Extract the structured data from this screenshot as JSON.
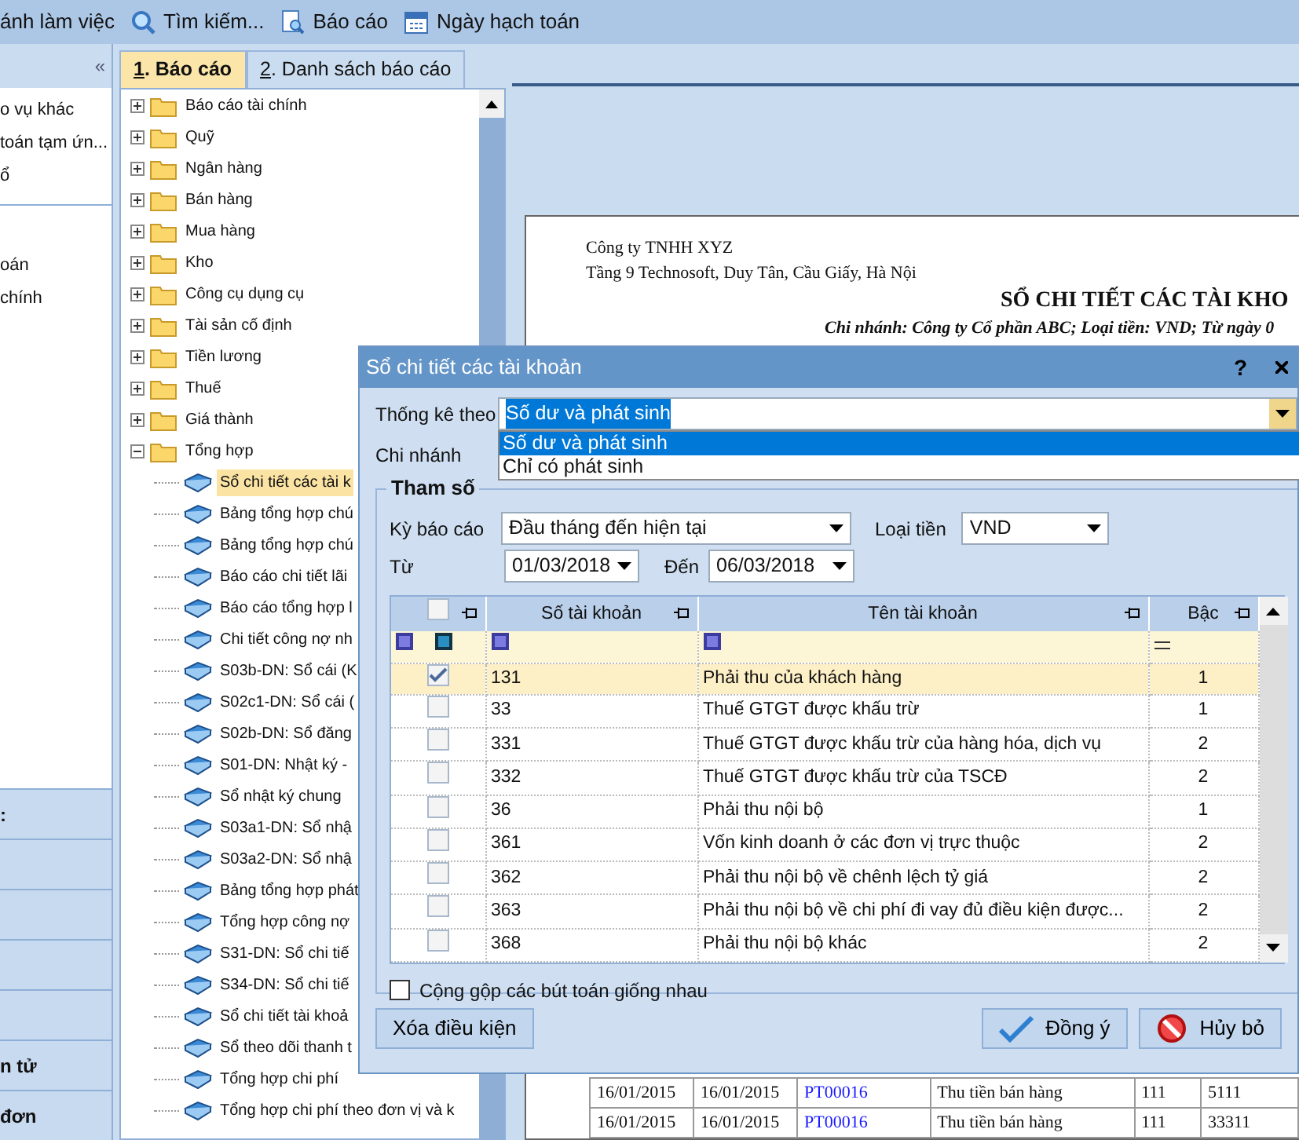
{
  "toolbar": [
    {
      "label": "ánh làm việc"
    },
    {
      "label": "Tìm kiếm..."
    },
    {
      "label": "Báo cáo"
    },
    {
      "label": "Ngày hạch toán"
    }
  ],
  "left_pane": {
    "collapse_glyph": "«",
    "list_1": [
      "o vụ khác",
      "toán tạm ứn...",
      "ổ"
    ],
    "list_2": [
      "oán",
      "chính"
    ],
    "nav_buttons": [
      ":",
      "n tử",
      "đơn"
    ]
  },
  "tabs": [
    {
      "number": "1",
      "label": ". Báo cáo",
      "selected": true
    },
    {
      "number": "2",
      "label": ". Danh sách báo cáo",
      "selected": false
    }
  ],
  "tree": [
    {
      "label": "Báo cáo tài chính",
      "expanded": false
    },
    {
      "label": "Quỹ",
      "expanded": false
    },
    {
      "label": "Ngân hàng",
      "expanded": false
    },
    {
      "label": "Bán hàng",
      "expanded": false
    },
    {
      "label": "Mua hàng",
      "expanded": false
    },
    {
      "label": "Kho",
      "expanded": false
    },
    {
      "label": "Công cụ dụng cụ",
      "expanded": false
    },
    {
      "label": "Tài sản cố định",
      "expanded": false
    },
    {
      "label": "Tiền lương",
      "expanded": false
    },
    {
      "label": "Thuế",
      "expanded": false
    },
    {
      "label": "Giá thành",
      "expanded": false
    },
    {
      "label": "Tổng hợp",
      "expanded": true,
      "children": [
        {
          "label": "Sổ chi tiết các tài k",
          "selected": true
        },
        {
          "label": "Bảng tổng hợp chú",
          "selected": false
        },
        {
          "label": "Bảng tổng hợp chú",
          "selected": false
        },
        {
          "label": "Báo cáo chi tiết lãi",
          "selected": false
        },
        {
          "label": "Báo cáo tổng hợp l",
          "selected": false
        },
        {
          "label": "Chi tiết công nợ nh",
          "selected": false
        },
        {
          "label": "S03b-DN: Sổ cái (K",
          "selected": false
        },
        {
          "label": "S02c1-DN: Sổ cái (",
          "selected": false
        },
        {
          "label": "S02b-DN: Sổ đăng",
          "selected": false
        },
        {
          "label": "S01-DN: Nhật ký -",
          "selected": false
        },
        {
          "label": "Sổ nhật ký chung",
          "selected": false
        },
        {
          "label": "S03a1-DN: Sổ nhậ",
          "selected": false
        },
        {
          "label": "S03a2-DN: Sổ nhậ",
          "selected": false
        },
        {
          "label": "Bảng tổng hợp phát",
          "selected": false
        },
        {
          "label": "Tổng hợp công nợ",
          "selected": false
        },
        {
          "label": "S31-DN: Sổ chi tiế",
          "selected": false
        },
        {
          "label": "S34-DN: Sổ chi tiế",
          "selected": false
        },
        {
          "label": "Sổ chi tiết tài khoả",
          "selected": false
        },
        {
          "label": "Sổ theo dõi thanh t",
          "selected": false
        },
        {
          "label": "Tổng hợp chi phí",
          "selected": false
        },
        {
          "label": "Tổng hợp chi phí theo đơn vị và k",
          "selected": false
        }
      ]
    }
  ],
  "report": {
    "company": "Công ty TNHH XYZ",
    "address": "Tầng 9 Technosoft, Duy Tân, Cầu Giấy, Hà Nội",
    "title": "SỔ CHI TIẾT CÁC TÀI KHO",
    "subtitle": "Chi nhánh: Công ty Cổ phần ABC; Loại tiền: VND; Từ ngày 0",
    "rows": [
      [
        "16/01/2015",
        "16/01/2015",
        "PT00016",
        "Thu tiền bán hàng",
        "111",
        "5111"
      ],
      [
        "16/01/2015",
        "16/01/2015",
        "PT00016",
        "Thu tiền bán hàng",
        "111",
        "33311"
      ]
    ]
  },
  "dialog": {
    "title": "Sổ chi tiết các tài khoản",
    "help": "?",
    "stat_label": "Thống kê theo",
    "stat_value": "Số dư và phát sinh",
    "stat_options": [
      {
        "label": "Số dư và phát sinh",
        "selected": true
      },
      {
        "label": "Chỉ có phát sinh",
        "selected": false
      }
    ],
    "branch_label": "Chi nhánh",
    "group_title": "Tham số",
    "period_label": "Kỳ báo cáo",
    "period_value": "Đầu tháng đến hiện tại",
    "currency_label": "Loại tiền",
    "currency_value": "VND",
    "from_label": "Từ",
    "from_value": "01/03/2018",
    "to_label": "Đến",
    "to_value": "06/03/2018",
    "select_all_checked": false,
    "columns": [
      "Số tài khoản",
      "Tên tài khoản",
      "Bậc"
    ],
    "rows": [
      {
        "account": "131",
        "name": "Phải thu của khách hàng",
        "level_no": "1",
        "checked": true,
        "selected": true
      },
      {
        "account": "33",
        "name": "Thuế GTGT được khấu trừ",
        "level_no": "1",
        "checked": false,
        "selected": false
      },
      {
        "account": "331",
        "name": "Thuế GTGT được khấu trừ của hàng hóa, dịch vụ",
        "level_no": "2",
        "checked": false,
        "selected": false
      },
      {
        "account": "332",
        "name": "Thuế GTGT được khấu trừ của TSCĐ",
        "level_no": "2",
        "checked": false,
        "selected": false
      },
      {
        "account": "36",
        "name": "Phải thu nội bộ",
        "level_no": "1",
        "checked": false,
        "selected": false
      },
      {
        "account": "361",
        "name": "Vốn kinh doanh ở các đơn vị trực thuộc",
        "level_no": "2",
        "checked": false,
        "selected": false
      },
      {
        "account": "362",
        "name": "Phải thu nội bộ về chênh lệch tỷ giá",
        "level_no": "2",
        "checked": false,
        "selected": false
      },
      {
        "account": "363",
        "name": "Phải thu nội bộ về chi phí đi vay đủ điều kiện được...",
        "level_no": "2",
        "checked": false,
        "selected": false
      },
      {
        "account": "368",
        "name": "Phải thu nội bộ khác",
        "level_no": "2",
        "checked": false,
        "selected": false
      }
    ],
    "merge_label": "Cộng gộp các bút toán giống nhau",
    "merge_checked": false,
    "buttons": [
      {
        "kind": "clear",
        "label": "Xóa điều kiện"
      },
      {
        "kind": "ok",
        "label": "Đồng ý"
      },
      {
        "kind": "cancel",
        "label": "Hủy bỏ"
      }
    ]
  }
}
